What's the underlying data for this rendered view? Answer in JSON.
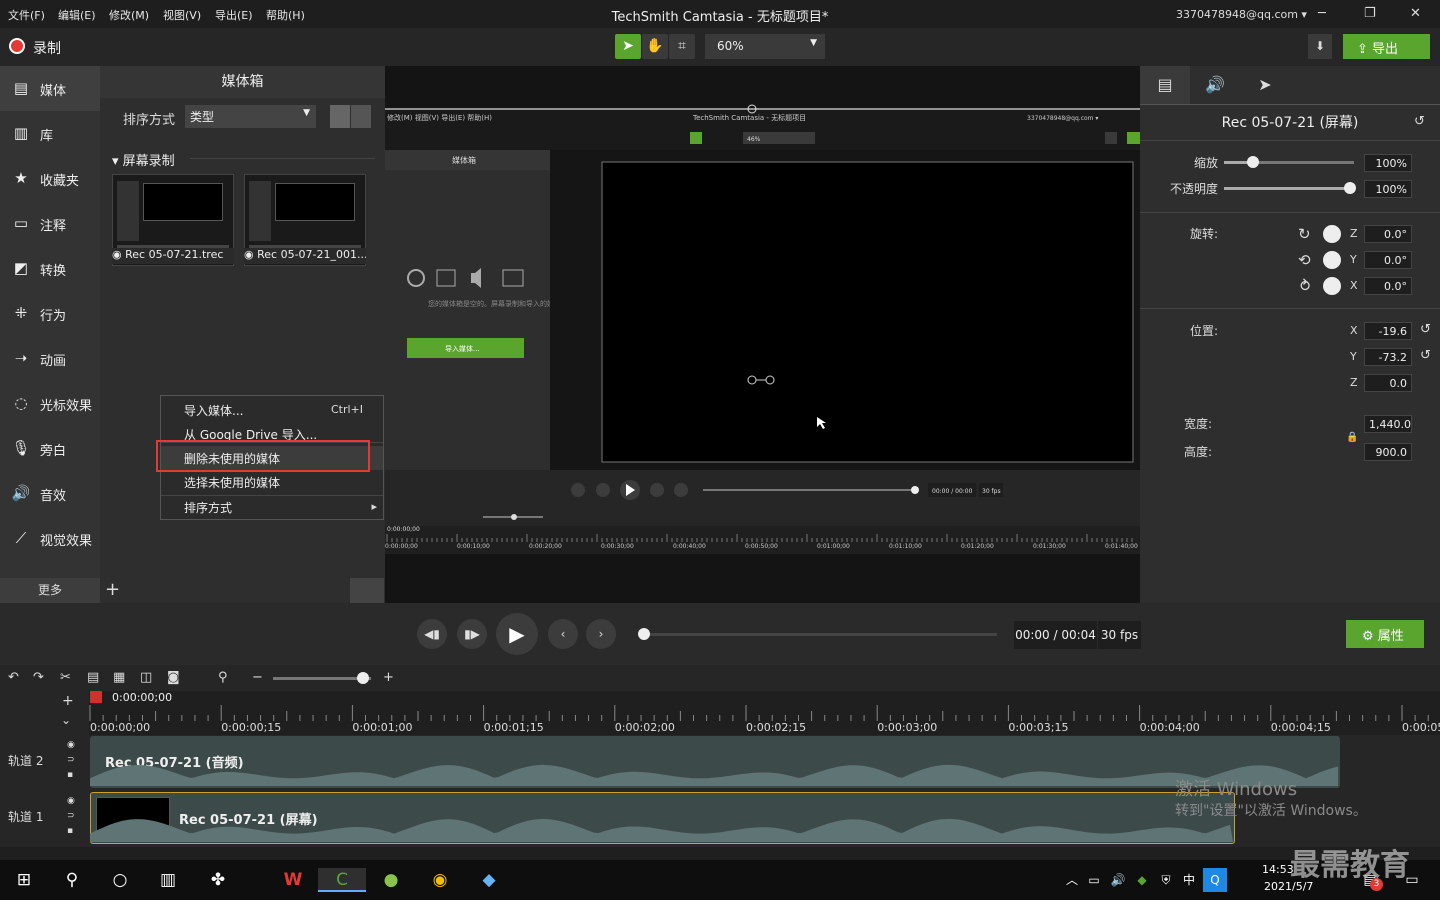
{
  "menubar": {
    "items": [
      "文件(F)",
      "编辑(E)",
      "修改(M)",
      "视图(V)",
      "导出(E)",
      "帮助(H)"
    ],
    "title": "TechSmith Camtasia - 无标题项目*",
    "account": "3370478948@qq.com ▾"
  },
  "toolbar": {
    "record_label": "录制",
    "zoom_value": "60%",
    "export_label": "导出"
  },
  "sidebar": {
    "items": [
      "媒体",
      "库",
      "收藏夹",
      "注释",
      "转换",
      "行为",
      "动画",
      "光标效果",
      "旁白",
      "音效",
      "视觉效果"
    ],
    "more_label": "更多"
  },
  "media_bin": {
    "title": "媒体箱",
    "sort_label": "排序方式",
    "sort_value": "类型",
    "section": "屏幕录制",
    "items": [
      "Rec 05-07-21.trec",
      "Rec 05-07-21_001..."
    ]
  },
  "context_menu": {
    "items": [
      {
        "label": "导入媒体...",
        "shortcut": "Ctrl+I"
      },
      {
        "label": "从 Google Drive 导入...",
        "shortcut": ""
      },
      {
        "label": "删除未使用的媒体",
        "shortcut": ""
      },
      {
        "label": "选择未使用的媒体",
        "shortcut": ""
      },
      {
        "label": "排序方式",
        "shortcut": "▸"
      }
    ]
  },
  "inner_preview": {
    "menu": "修改(M)   视图(V)   导出(E)   帮助(H)",
    "title": "TechSmith Camtasia - 无标题项目",
    "account": "3370478948@qq.com ▾",
    "zoom": "46%",
    "bin_title": "媒体箱",
    "empty_text": "您的媒体箱是空的。屏幕录制和导入的媒体将显示在此处。",
    "import_btn": "导入媒体...",
    "time": "00:00 / 00:00",
    "fps": "30 fps",
    "playhead": "0:00:00;00",
    "ticks": [
      "0:00:00;00",
      "0:00:10;00",
      "0:00:20;00",
      "0:00:30;00",
      "0:00:40;00",
      "0:00:50;00",
      "0:01:00;00",
      "0:01:10;00",
      "0:01:20;00",
      "0:01:30;00",
      "0:01:40;00"
    ]
  },
  "properties": {
    "title": "Rec 05-07-21 (屏幕)",
    "scale_label": "缩放",
    "scale_value": "100%",
    "opacity_label": "不透明度",
    "opacity_value": "100%",
    "rotation_label": "旋转:",
    "rot_z": "0.0°",
    "rot_y": "0.0°",
    "rot_x": "0.0°",
    "position_label": "位置:",
    "pos_x": "-19.6",
    "pos_y": "-73.2",
    "pos_z": "0.0",
    "width_label": "宽度:",
    "width_value": "1,440.0",
    "height_label": "高度:",
    "height_value": "900.0",
    "axis_z": "Z",
    "axis_y": "Y",
    "axis_x": "X"
  },
  "playback": {
    "time": "00:00 / 00:04",
    "fps": "30 fps",
    "properties_label": "属性"
  },
  "timeline": {
    "playhead": "0:00:00;00",
    "ticks": [
      "0:00:00;00",
      "0:00:00;15",
      "0:00:01;00",
      "0:00:01;15",
      "0:00:02;00",
      "0:00:02;15",
      "0:00:03;00",
      "0:00:03;15",
      "0:00:04;00",
      "0:00:04;15",
      "0:00:05"
    ],
    "tracks": [
      {
        "label": "轨道 2",
        "clip": "Rec 05-07-21 (音频)"
      },
      {
        "label": "轨道 1",
        "clip": "Rec 05-07-21 (屏幕)"
      }
    ]
  },
  "overlay": {
    "activate_title": "激活 Windows",
    "activate_sub": "转到\"设置\"以激活 Windows。",
    "brand": "最需教育"
  },
  "taskbar": {
    "time": "14:53",
    "date": "2021/5/7",
    "ime": "中",
    "badge_count": "3"
  }
}
